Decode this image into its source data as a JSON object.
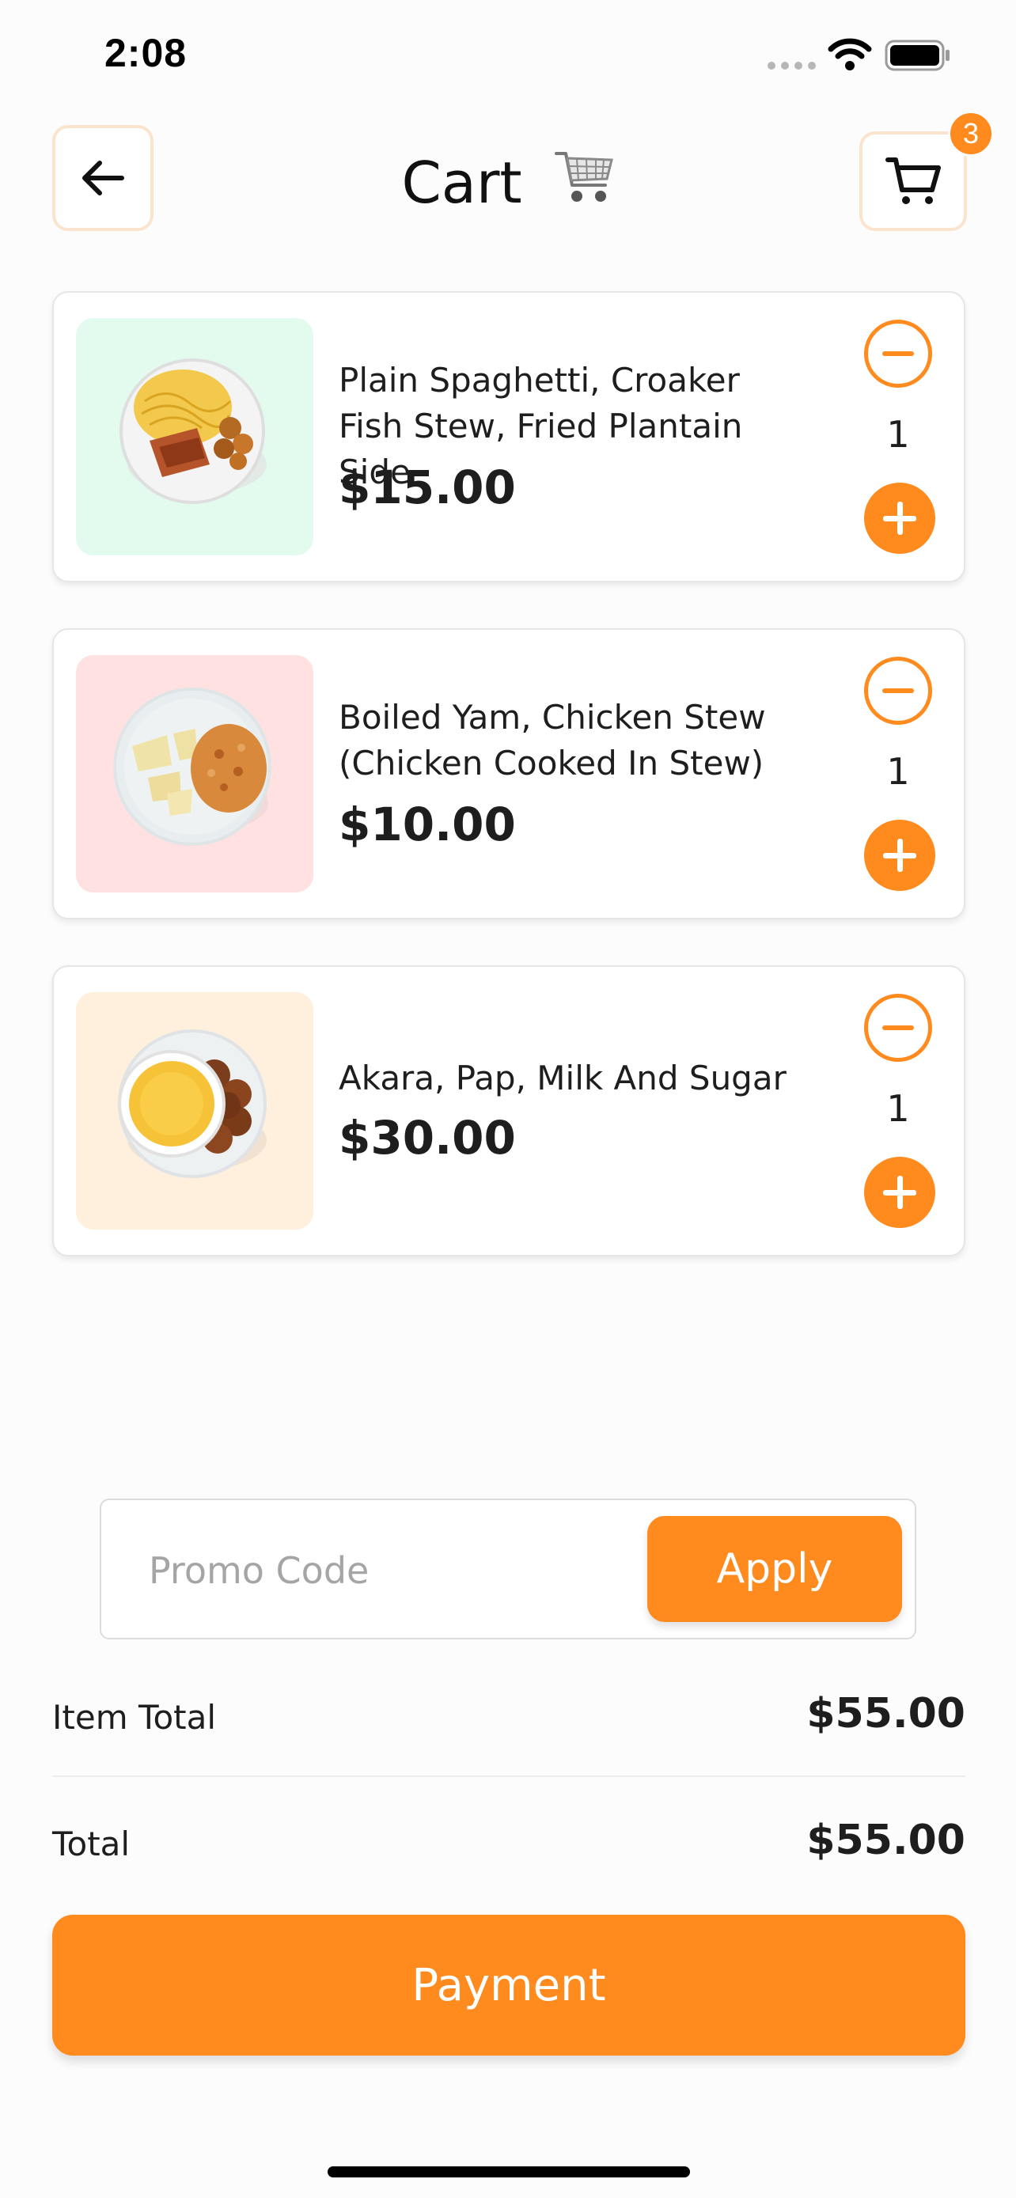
{
  "status_bar": {
    "time": "2:08"
  },
  "header": {
    "title": "Cart",
    "cart_badge_count": "3",
    "back_icon": "arrow-left-icon",
    "cart_icon": "shopping-cart-icon"
  },
  "cart": {
    "items": [
      {
        "name": "Plain Spaghetti, Croaker Fish Stew, Fried Plantain Side",
        "price": "$15.00",
        "quantity": "1",
        "thumb_bg": "#e3fbef"
      },
      {
        "name": "Boiled Yam, Chicken Stew (Chicken Cooked In Stew)",
        "price": "$10.00",
        "quantity": "1",
        "thumb_bg": "#ffe1e1"
      },
      {
        "name": "Akara, Pap, Milk And Sugar",
        "price": "$30.00",
        "quantity": "1",
        "thumb_bg": "#ffefdd"
      }
    ]
  },
  "promo": {
    "placeholder": "Promo Code",
    "apply_label": "Apply"
  },
  "totals": {
    "item_total_label": "Item Total",
    "item_total_value": "$55.00",
    "total_label": "Total",
    "total_value": "$55.00"
  },
  "payment": {
    "label": "Payment"
  },
  "colors": {
    "accent": "#ff8a1d",
    "accent_light": "#fbe4cd"
  }
}
